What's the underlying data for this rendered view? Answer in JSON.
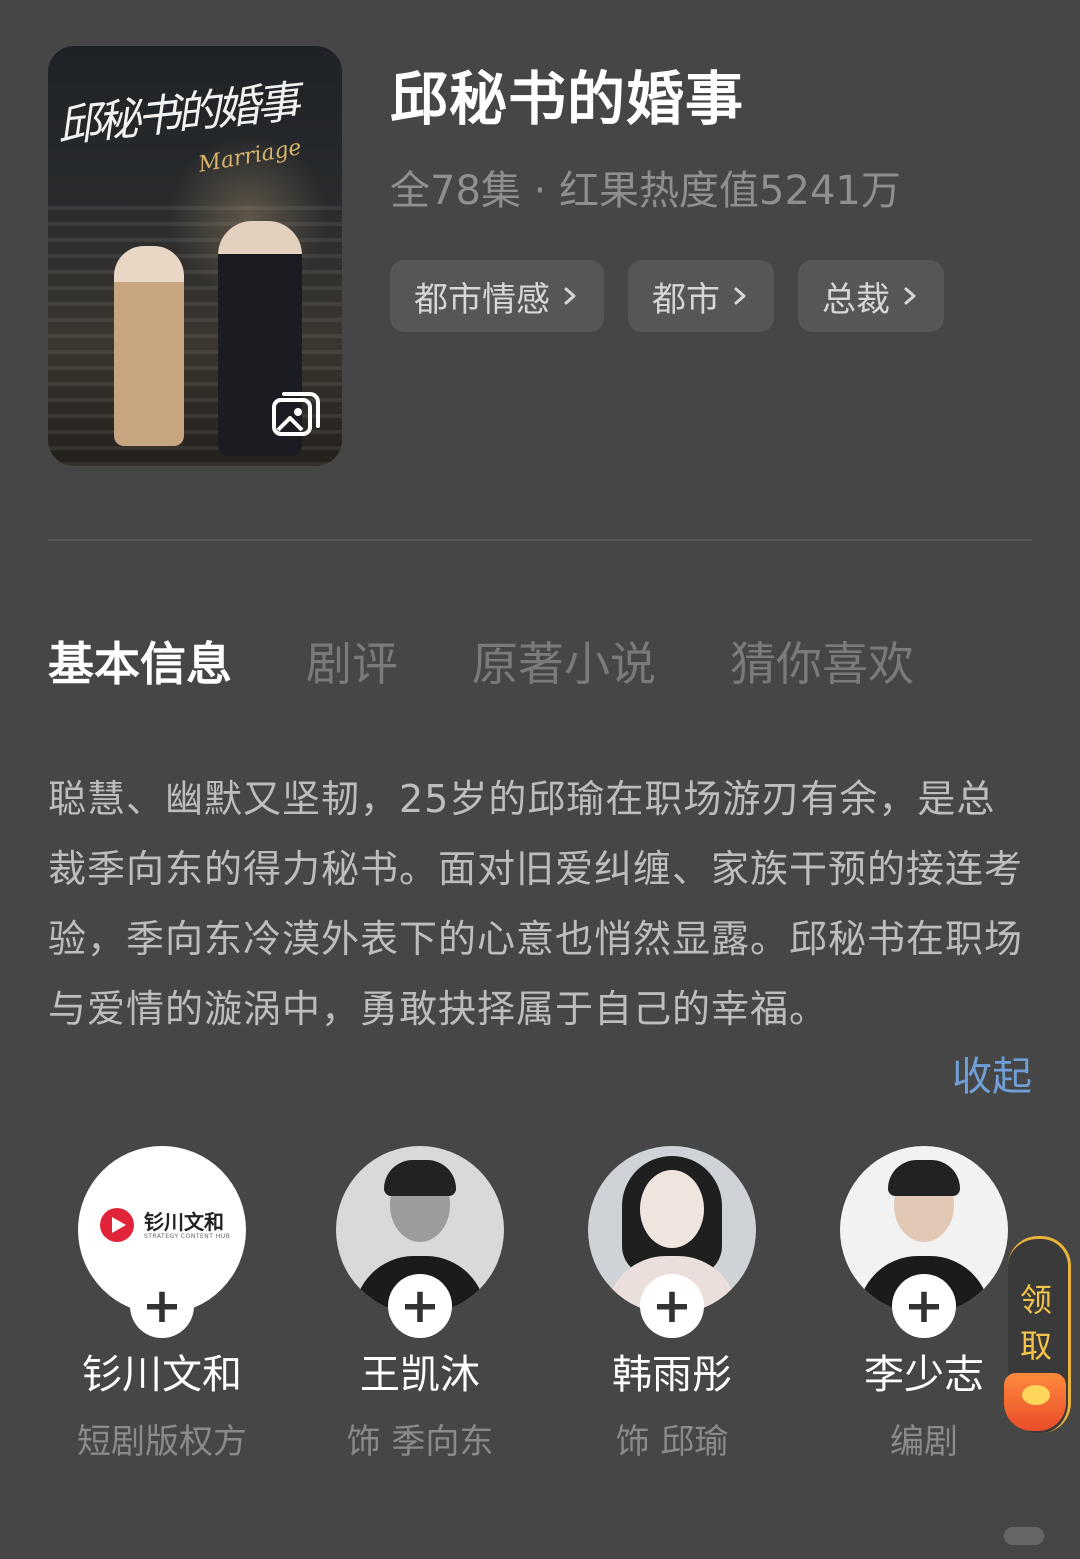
{
  "show": {
    "title": "邱秘书的婚事",
    "meta": "全78集 · 红果热度值5241万",
    "poster_title": "邱秘书的婚事",
    "poster_subtitle": "Marriage",
    "tags": [
      {
        "label": "都市情感"
      },
      {
        "label": "都市"
      },
      {
        "label": "总裁"
      }
    ]
  },
  "tabs": [
    {
      "label": "基本信息",
      "active": true
    },
    {
      "label": "剧评"
    },
    {
      "label": "原著小说"
    },
    {
      "label": "猜你喜欢"
    }
  ],
  "synopsis": {
    "text": "聪慧、幽默又坚韧，25岁的邱瑜在职场游刃有余，是总裁季向东的得力秘书。面对旧爱纠缠、家族干预的接连考验，季向东冷漠外表下的心意也悄然显露。邱秘书在职场与爱情的漩涡中，勇敢抉择属于自己的幸福。",
    "collapse_label": "收起"
  },
  "cast": [
    {
      "name": "钐川文和",
      "role": "短剧版权方",
      "logo_name": "钐川文和",
      "logo_sub": "STRATEGY CONTENT HUB"
    },
    {
      "name": "王凯沐",
      "role": "饰 季向东"
    },
    {
      "name": "韩雨彤",
      "role": "饰 邱瑜"
    },
    {
      "name": "李少志",
      "role": "编剧"
    }
  ],
  "reward": {
    "label": "领取"
  },
  "icons": {
    "gallery": "gallery-icon",
    "chevron": "chevron-right-icon",
    "follow": "plus-icon"
  },
  "colors": {
    "background": "#464646",
    "accent_link": "#6f9fd6",
    "reward_gold": "#f3c34a"
  }
}
